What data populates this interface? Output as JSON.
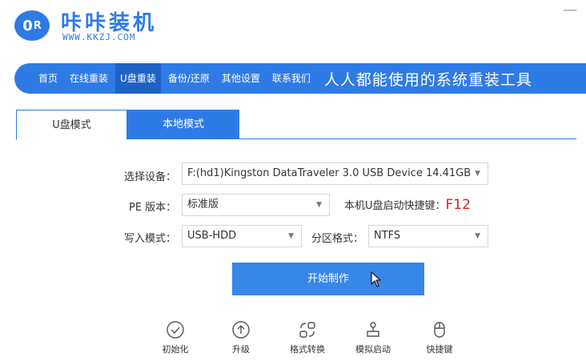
{
  "app": {
    "logo_text": "0",
    "title": "咔咔装机",
    "url": "WWW.KKZJ.COM",
    "minimize_glyph": "—"
  },
  "nav": {
    "items": [
      {
        "label": "首页"
      },
      {
        "label": "在线重装"
      },
      {
        "label": "U盘重装"
      },
      {
        "label": "备份/还原"
      },
      {
        "label": "其他设置"
      },
      {
        "label": "联系我们"
      }
    ],
    "active_index": 2,
    "slogan": "人人都能使用的系统重装工具"
  },
  "tabs": [
    {
      "label": "U盘模式"
    },
    {
      "label": "本地模式"
    }
  ],
  "form": {
    "device_label": "选择设备：",
    "device_value": "F:(hd1)Kingston DataTraveler 3.0 USB Device 14.41GB",
    "pe_label": "PE 版本：",
    "pe_value": "标准版",
    "hotkey_label": "本机U盘启动快捷键：",
    "hotkey_value": "F12",
    "write_label": "写入模式：",
    "write_value": "USB-HDD",
    "partition_label": "分区格式：",
    "partition_value": "NTFS",
    "caret_glyph": "▼"
  },
  "start_button": {
    "label": "开始制作"
  },
  "tools": [
    {
      "label": "初始化",
      "icon": "check-circle-icon"
    },
    {
      "label": "升级",
      "icon": "upload-circle-icon"
    },
    {
      "label": "格式转换",
      "icon": "convert-icon"
    },
    {
      "label": "模拟启动",
      "icon": "simulate-boot-icon"
    },
    {
      "label": "快捷键",
      "icon": "mouse-icon"
    }
  ],
  "colors": {
    "brand": "#2f7be6",
    "nav_active": "#1f62c6",
    "hotkey": "#e0201b"
  }
}
